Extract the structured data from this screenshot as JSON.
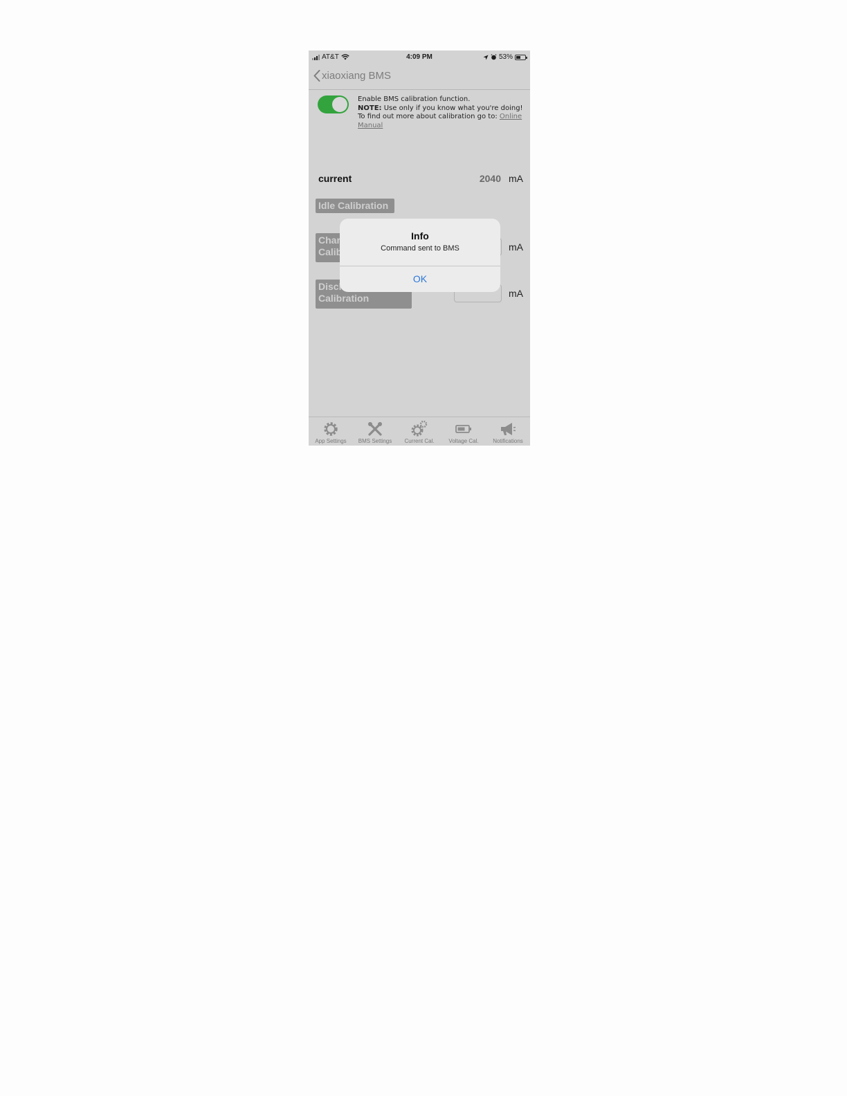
{
  "status_bar": {
    "carrier": "AT&T",
    "time": "4:09 PM",
    "battery": "53%",
    "battery_level": 0.53
  },
  "nav": {
    "back_label": "xiaoxiang BMS"
  },
  "calibration": {
    "enabled": true,
    "enable_text": "Enable BMS calibration function.",
    "note_label": "NOTE:",
    "note_text": " Use only if you know what you're doing! To find out more about calibration go to: ",
    "manual_link": "Online Manual"
  },
  "current": {
    "label": "current",
    "value": "2040",
    "unit": "mA"
  },
  "buttons": {
    "idle": "Idle Calibration",
    "charge_line1": "Charge",
    "charge_line2": "Calibration",
    "discharge_line1": "Discharge",
    "discharge_line2": "Calibration",
    "charge_unit": "mA",
    "discharge_unit": "mA"
  },
  "alert": {
    "title": "Info",
    "message": "Command sent to BMS",
    "ok": "OK"
  },
  "tabs": [
    {
      "label": "App Settings",
      "icon": "gear-icon"
    },
    {
      "label": "BMS Settings",
      "icon": "tools-icon"
    },
    {
      "label": "Current Cal.",
      "icon": "gears-icon"
    },
    {
      "label": "Voltage Cal.",
      "icon": "battery-icon"
    },
    {
      "label": "Notifications",
      "icon": "megaphone-icon"
    }
  ]
}
